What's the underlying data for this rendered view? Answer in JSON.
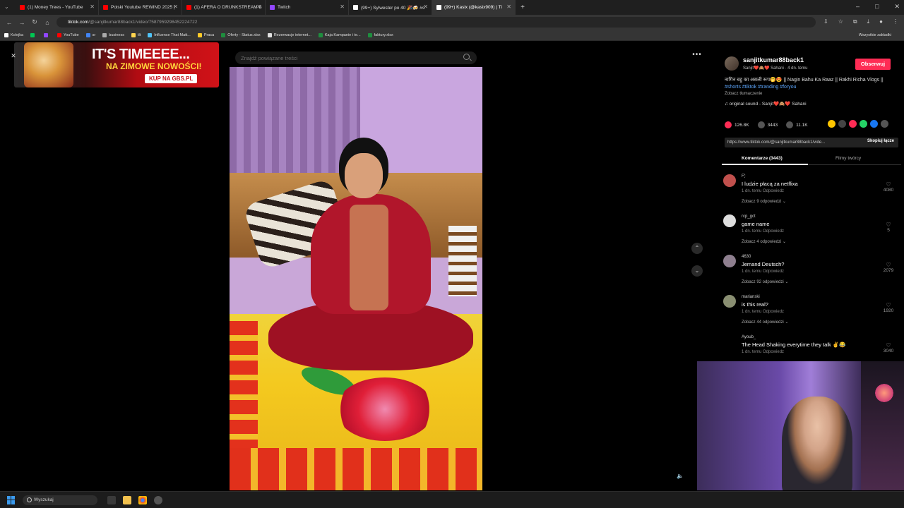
{
  "browser": {
    "tabs": [
      {
        "title": "(1) Money Trees - YouTube",
        "color": "#ff0000"
      },
      {
        "title": "Polski Youtube REWIND 2025 |",
        "color": "#ff0000"
      },
      {
        "title": "(1) AFERA O DRUNKSTREAM B",
        "color": "#ff0000"
      },
      {
        "title": "Twitch",
        "color": "#9146ff"
      },
      {
        "title": "(99+) Sylwester po 40 🎉🍻 #s",
        "color": "#ffffff"
      },
      {
        "title": "(99+) Kasix (@kasix909) | Ti",
        "color": "#ffffff",
        "active": true
      }
    ],
    "new_tab": "+",
    "window_controls": [
      "–",
      "□",
      "✕"
    ],
    "url_host": "tiktok.com",
    "url_path": "/@sanjitkumar88back1/video/7587959298452224722",
    "bookmarks": [
      {
        "label": "Kolejka",
        "color": "#ffffff"
      },
      {
        "label": "",
        "color": "#00c853"
      },
      {
        "label": "",
        "color": "#9146ff"
      },
      {
        "label": "YouTube",
        "color": "#ff0000"
      },
      {
        "label": "sr",
        "color": "#4285f4"
      },
      {
        "label": "business",
        "color": "#aaaaaa"
      },
      {
        "label": "tlt",
        "color": "#ffd54f"
      },
      {
        "label": "Influence That Matt...",
        "color": "#4fc3f7"
      },
      {
        "label": "Praca",
        "color": "#ffca28"
      },
      {
        "label": "Oferty - Status.xlsx",
        "color": "#1e8e3e"
      },
      {
        "label": "Rezerwacje internet...",
        "color": "#e0e0e0"
      },
      {
        "label": "Kaja Kampanie i te...",
        "color": "#1e8e3e"
      },
      {
        "label": "faktury.xlsx",
        "color": "#1e8e3e"
      }
    ],
    "all_bookmarks": "Wszystkie zakładki"
  },
  "ad": {
    "headline": "IT'S TIMEEEE...",
    "sub": "NA ZIMOWE NOWOŚCI!",
    "cta": "KUP NA GBS.PL"
  },
  "search": {
    "placeholder": "Znajdź powiązane treści"
  },
  "post": {
    "username": "sanjitkumar88back1",
    "subline": "Sanjit❤️🙈❤️ Sahani · 4 dn. temu",
    "follow": "Obserwuj",
    "description": "नागिन बहु का असली रूप🤭😍 || Nagin Bahu Ka Raaz || Rakhi Richa Vlogs ||",
    "tags": "#shorts #tiktok #tranding #foryou",
    "translate": "Zobacz tłumaczenie",
    "sound": "♫  original sound - Sanjit❤️🙈❤️ Sahani",
    "likes": "126.8K",
    "comments_count": "3443",
    "saves": "11.1K",
    "link": "https://www.tiktok.com/@sanjitkumar88back1/vide...",
    "copy_link": "Skopiuj łącze",
    "tab_comments": "Komentarze (3443)",
    "tab_videos": "Filmy twórcy"
  },
  "comments": [
    {
      "user": "F🕯",
      "text": "I ludzie płacą za netflixa",
      "meta": "1 dn. temu     Odpowiedz",
      "replies": "Zobacz 9 odpowiedzi ⌄",
      "likes": "4080",
      "color": "#c0504d"
    },
    {
      "user": "rcp_gct",
      "text": "game name",
      "meta": "1 dn. temu     Odpowiedz",
      "replies": "Zobacz 4 odpowiedzi ⌄",
      "likes": "5",
      "color": "#dddddd"
    },
    {
      "user": "4630",
      "text": "Jemand Deutsch?",
      "meta": "1 dn. temu     Odpowiedz",
      "replies": "Zobacz 92 odpowiedzi ⌄",
      "likes": "2079",
      "color": "#8e7f8f"
    },
    {
      "user": "marianski",
      "text": "is this real?",
      "meta": "1 dn. temu     Odpowiedz",
      "replies": "Zobacz 44 odpowiedzi ⌄",
      "likes": "1920",
      "color": "#8a8f72"
    },
    {
      "user": "Ayoub_",
      "text": "The Head Shaking everytime they talk ✌️😂",
      "meta": "1 dn. temu     Odpowiedz",
      "replies": "",
      "likes": "3040",
      "color": "#000000"
    }
  ],
  "taskbar": {
    "search": "Wyszukaj"
  }
}
